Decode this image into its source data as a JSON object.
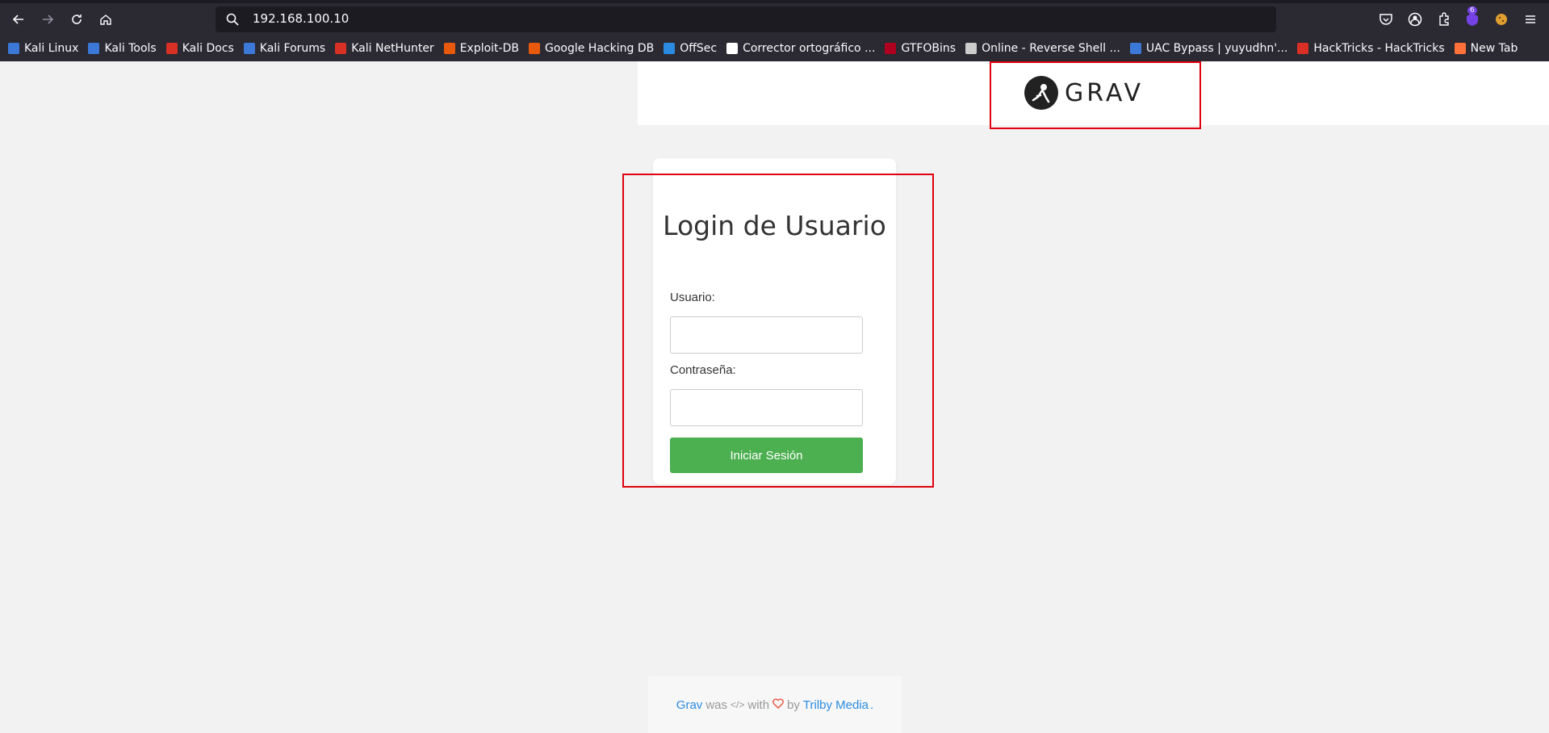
{
  "browser": {
    "url": "192.168.100.10",
    "extension_badge": "6",
    "bookmarks": [
      {
        "label": "Kali Linux",
        "color": "#3b78d8"
      },
      {
        "label": "Kali Tools",
        "color": "#3b78d8"
      },
      {
        "label": "Kali Docs",
        "color": "#d93025"
      },
      {
        "label": "Kali Forums",
        "color": "#3b78d8"
      },
      {
        "label": "Kali NetHunter",
        "color": "#d93025"
      },
      {
        "label": "Exploit-DB",
        "color": "#e8590c"
      },
      {
        "label": "Google Hacking DB",
        "color": "#e8590c"
      },
      {
        "label": "OffSec",
        "color": "#2a8be0"
      },
      {
        "label": "Corrector ortográfico ...",
        "color": "#ffffff"
      },
      {
        "label": "GTFOBins",
        "color": "#b00020"
      },
      {
        "label": "Online - Reverse Shell ...",
        "color": "#cccccc"
      },
      {
        "label": "UAC Bypass | yuyudhn'...",
        "color": "#3b78d8"
      },
      {
        "label": "HackTricks - HackTricks",
        "color": "#d93025"
      },
      {
        "label": "New Tab",
        "color": "#ff7139"
      }
    ]
  },
  "header": {
    "logo_text": "GRAV"
  },
  "login": {
    "title": "Login de Usuario",
    "user_label": "Usuario:",
    "password_label": "Contraseña:",
    "submit_label": "Iniciar Sesión",
    "submit_color": "#4caf50"
  },
  "footer": {
    "grav_link": "Grav",
    "was": "was",
    "code_icon": "</>",
    "with": "with",
    "by": "by",
    "trilby_link": "Trilby Media",
    "period": "."
  },
  "annotations": {
    "highlight_color": "#e0000f"
  }
}
